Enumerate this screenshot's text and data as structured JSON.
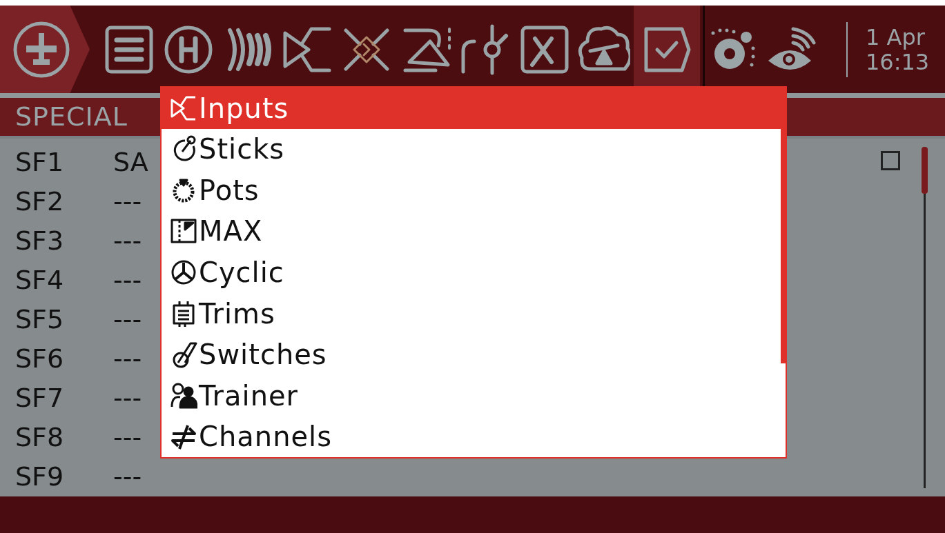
{
  "top_bar": {
    "model_button": {
      "selected": false
    },
    "tabs": [
      {
        "kind": "setup",
        "selected": false
      },
      {
        "kind": "heli",
        "selected": false
      },
      {
        "kind": "flightmodes",
        "selected": false
      },
      {
        "kind": "inputs",
        "selected": false
      },
      {
        "kind": "mixes",
        "selected": false
      },
      {
        "kind": "outputs",
        "selected": false
      },
      {
        "kind": "curves",
        "selected": false
      },
      {
        "kind": "gvars",
        "selected": false
      },
      {
        "kind": "logical",
        "selected": false
      },
      {
        "kind": "special",
        "selected": true
      },
      {
        "kind": "scripts",
        "selected": false
      },
      {
        "kind": "telemetry",
        "selected": false
      }
    ],
    "date": "1 Apr",
    "time": "16:13"
  },
  "page_title": "SPECIAL",
  "rows": [
    {
      "name": "SF1",
      "switch": "SA",
      "enabled": false
    },
    {
      "name": "SF2",
      "switch": "---"
    },
    {
      "name": "SF3",
      "switch": "---"
    },
    {
      "name": "SF4",
      "switch": "---"
    },
    {
      "name": "SF5",
      "switch": "---"
    },
    {
      "name": "SF6",
      "switch": "---"
    },
    {
      "name": "SF7",
      "switch": "---"
    },
    {
      "name": "SF8",
      "switch": "---"
    },
    {
      "name": "SF9",
      "switch": "---"
    }
  ],
  "menu": {
    "items": [
      {
        "kind": "inputs",
        "label": "Inputs",
        "selected": true
      },
      {
        "kind": "sticks",
        "label": "Sticks",
        "selected": false
      },
      {
        "kind": "pots",
        "label": "Pots",
        "selected": false
      },
      {
        "kind": "max",
        "label": "MAX",
        "selected": false
      },
      {
        "kind": "cyclic",
        "label": "Cyclic",
        "selected": false
      },
      {
        "kind": "trims",
        "label": "Trims",
        "selected": false
      },
      {
        "kind": "switches",
        "label": "Switches",
        "selected": false
      },
      {
        "kind": "trainer",
        "label": "Trainer",
        "selected": false
      },
      {
        "kind": "channels",
        "label": "Channels",
        "selected": false
      }
    ]
  }
}
